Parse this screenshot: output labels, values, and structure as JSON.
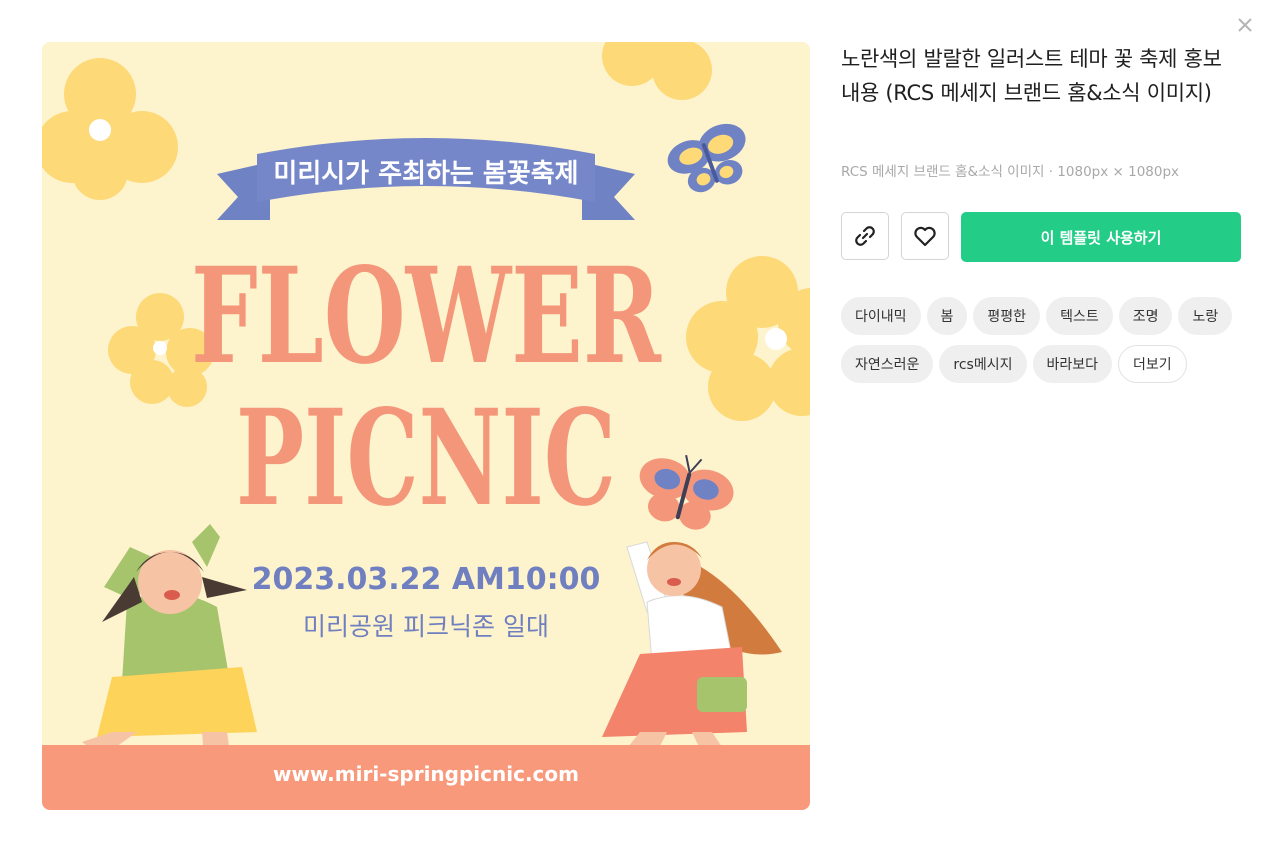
{
  "dialog": {
    "close_label": "×"
  },
  "preview": {
    "banner_text": "미리시가 주최하는 봄꽃축제",
    "headline_line1": "FLOWER",
    "headline_line2": "PICNIC",
    "date_text": "2023.03.22 AM10:00",
    "location_text": "미리공원 피크닉존 일대",
    "url_text": "www.miri-springpicnic.com",
    "colors": {
      "background": "#fdf3cd",
      "headline": "#f4967a",
      "banner": "#6f82c4",
      "date": "#6f7fc0",
      "flower": "#fdd978",
      "footer": "#f8997c"
    }
  },
  "template": {
    "title": "노란색의 발랄한 일러스트 테마 꽃 축제 홍보 내용 (RCS 메세지 브랜드 홈&소식 이미지)",
    "meta": "RCS 메세지 브랜드 홈&소식 이미지 · 1080px × 1080px"
  },
  "actions": {
    "link_icon": "link-icon",
    "heart_icon": "heart-icon",
    "use_label": "이 템플릿 사용하기",
    "use_color": "#23cc87"
  },
  "tags": [
    "다이내믹",
    "봄",
    "평평한",
    "텍스트",
    "조명",
    "노랑",
    "자연스러운",
    "rcs메시지",
    "바라보다"
  ],
  "more_label": "더보기"
}
